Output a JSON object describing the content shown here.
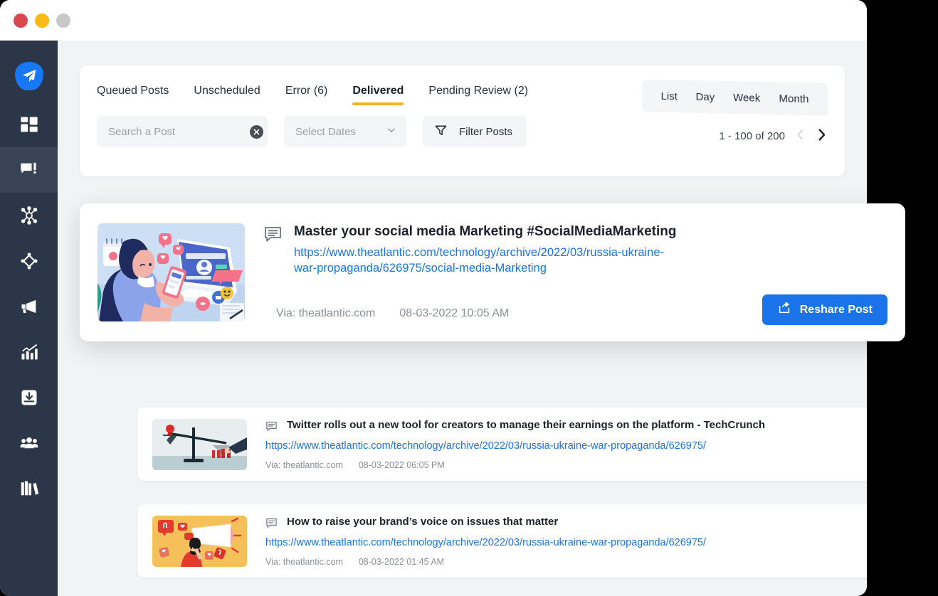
{
  "window": {
    "traffic_lights": [
      "close",
      "minimize",
      "maximize"
    ]
  },
  "sidebar": {
    "logo_icon": "paper-plane-icon",
    "items": [
      {
        "icon": "dashboard-grid-icon",
        "active": false
      },
      {
        "icon": "comment-edit-icon",
        "active": true
      },
      {
        "icon": "network-nodes-icon",
        "active": false
      },
      {
        "icon": "diamond-shapes-icon",
        "active": false
      },
      {
        "icon": "megaphone-icon",
        "active": false
      },
      {
        "icon": "analytics-chart-icon",
        "active": false
      },
      {
        "icon": "inbox-download-icon",
        "active": false
      },
      {
        "icon": "users-team-icon",
        "active": false
      },
      {
        "icon": "library-books-icon",
        "active": false
      }
    ]
  },
  "toolbar": {
    "tabs": [
      {
        "label": "Queued Posts",
        "active": false
      },
      {
        "label": "Unscheduled",
        "active": false
      },
      {
        "label": "Error (6)",
        "active": false
      },
      {
        "label": "Delivered",
        "active": true
      },
      {
        "label": "Pending Review (2)",
        "active": false
      }
    ],
    "active_tab_underline_color": "#f7b32b",
    "search": {
      "placeholder": "Search a Post",
      "value": "",
      "clear_icon": "clear-circle-icon"
    },
    "date_select": {
      "label": "Select Dates",
      "chevron_icon": "chevron-down-icon"
    },
    "filter": {
      "label": "Filter Posts",
      "icon": "funnel-icon"
    },
    "view_switch": {
      "options": [
        "List",
        "Day",
        "Week",
        "Month"
      ],
      "selected": "List"
    },
    "pagination": {
      "range_label": "1 - 100 of 200",
      "prev_icon": "chevron-left-icon",
      "next_icon": "chevron-right-icon"
    }
  },
  "featured_post": {
    "thumb_alt": "woman-at-desk-social-media-illustration",
    "type_icon": "comment-icon",
    "title": "Master your social media Marketing #SocialMediaMarketing",
    "link": "https://www.theatlantic.com/technology/archive/2022/03/russia-ukraine-war-propaganda/626975/social-media-Marketing",
    "via": "Via: theatlantic.com",
    "datetime": "08-03-2022 10:05 AM",
    "action": {
      "label": "Reshare Post",
      "icon": "share-box-icon",
      "color": "#1a73e8"
    }
  },
  "posts": [
    {
      "thumb_alt": "balance-scale-lightbulb-money-illustration",
      "type_icon": "comment-icon",
      "title": "Twitter rolls out a new tool for creators to manage their earnings on the platform - TechCrunch",
      "link": "https://www.theatlantic.com/technology/archive/2022/03/russia-ukraine-war-propaganda/626975/",
      "via": "Via: theatlantic.com",
      "datetime": "08-03-2022 06:05 PM"
    },
    {
      "thumb_alt": "woman-with-megaphone-illustration",
      "type_icon": "comment-icon",
      "title": "How to raise your brand’s voice on issues that matter",
      "link": "https://www.theatlantic.com/technology/archive/2022/03/russia-ukraine-war-propaganda/626975/",
      "via": "Via: theatlantic.com",
      "datetime": "08-03-2022 01:45 AM"
    }
  ],
  "colors": {
    "sidebar_bg": "#2b3648",
    "canvas_bg": "#f2f3f5",
    "accent_blue": "#1a73e8",
    "accent_amber": "#f7b32b",
    "link_blue": "#1a73e8"
  }
}
